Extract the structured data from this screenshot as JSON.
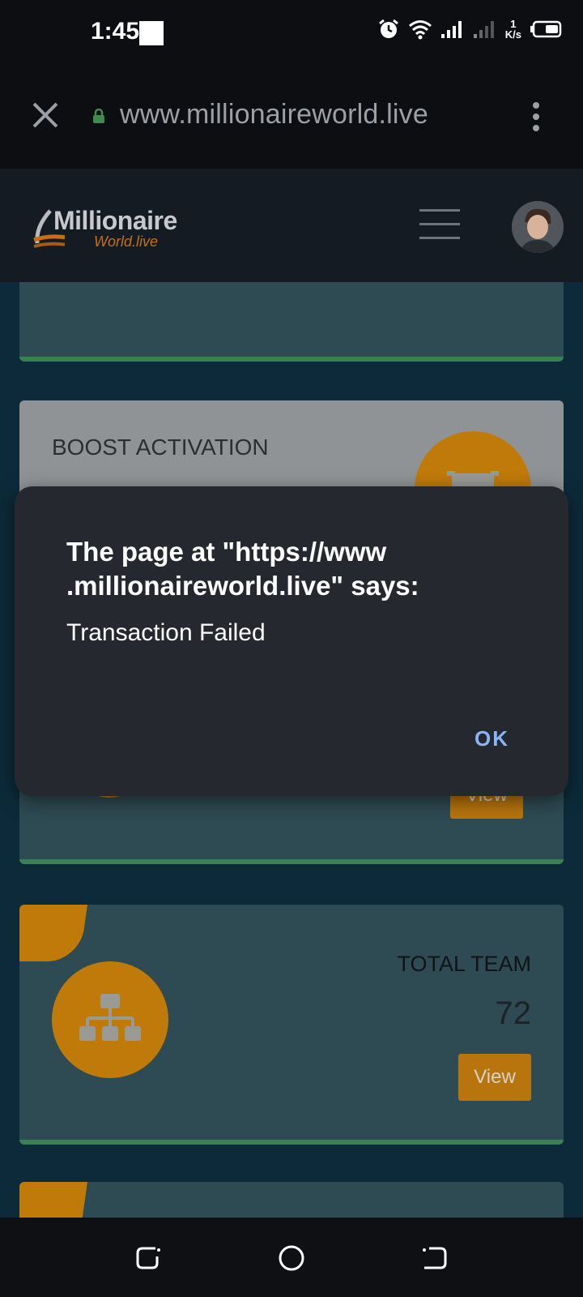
{
  "status_bar": {
    "time": "1:45",
    "net_speed_value": "1",
    "net_speed_unit": "K/s",
    "icons": [
      "alarm-icon",
      "wifi-icon",
      "signal-icon",
      "signal-weak-icon",
      "battery-icon"
    ]
  },
  "browser": {
    "url": "www.millionaireworld.live",
    "icons": [
      "close-icon",
      "lock-icon",
      "more-vert-icon"
    ]
  },
  "site_header": {
    "logo_main": "Millionaire",
    "logo_sub": "World.live",
    "icons": [
      "hamburger-menu-icon",
      "avatar"
    ]
  },
  "cards": {
    "boost_title": "BOOST ACTIVATION",
    "boost_view_label": "View",
    "team_title": "TOTAL TEAM",
    "team_count": "72",
    "team_view_label": "View"
  },
  "dialog": {
    "title": "The page at \"https://www .millionaireworld.live\" says:",
    "message": "Transaction Failed",
    "ok_label": "OK"
  },
  "nav_bar": {
    "icons": [
      "recent-apps-icon",
      "home-icon",
      "back-icon"
    ]
  },
  "colors": {
    "accent_orange": "#c07a0a",
    "card_bg": "#2e4a52",
    "dialog_bg": "#25292f",
    "ok_blue": "#8ab4f8"
  }
}
